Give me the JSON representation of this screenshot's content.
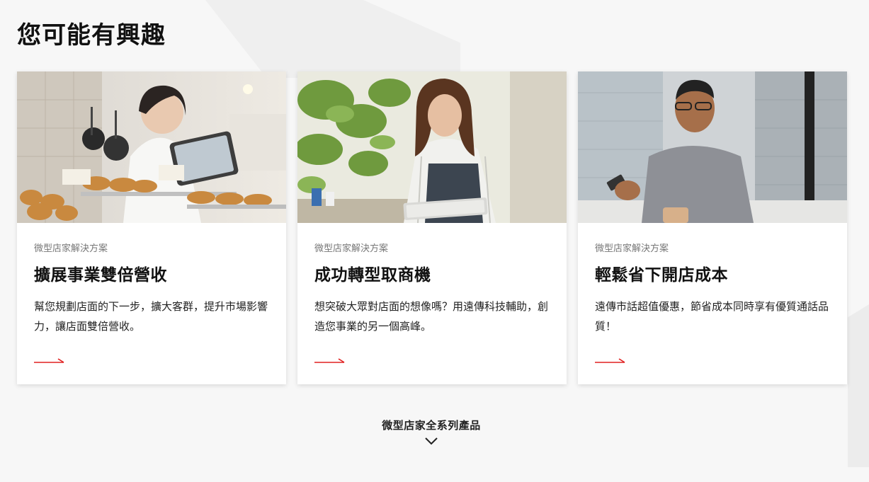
{
  "section": {
    "title": "您可能有興趣"
  },
  "cards": [
    {
      "category": "微型店家解決方案",
      "title": "擴展事業雙倍營收",
      "description": "幫您規劃店面的下一步，擴大客群，提升市場影響力，讓店面雙倍營收。",
      "image": "photo-bakery-owner-tablet"
    },
    {
      "category": "微型店家解決方案",
      "title": "成功轉型取商機",
      "description": "想突破大眾對店面的想像嗎？用遠傳科技輔助，創造您事業的另一個高峰。",
      "image": "photo-barista-woman-tablet"
    },
    {
      "category": "微型店家解決方案",
      "title": "輕鬆省下開店成本",
      "description": "遠傳市話超值優惠，節省成本同時享有優質通話品質！",
      "image": "photo-man-smartphone-coffee"
    }
  ],
  "more": {
    "label": "微型店家全系列產品",
    "icon": "chevron-down-icon"
  },
  "colors": {
    "accent": "#e02020",
    "background": "#f7f7f7",
    "card": "#ffffff"
  }
}
